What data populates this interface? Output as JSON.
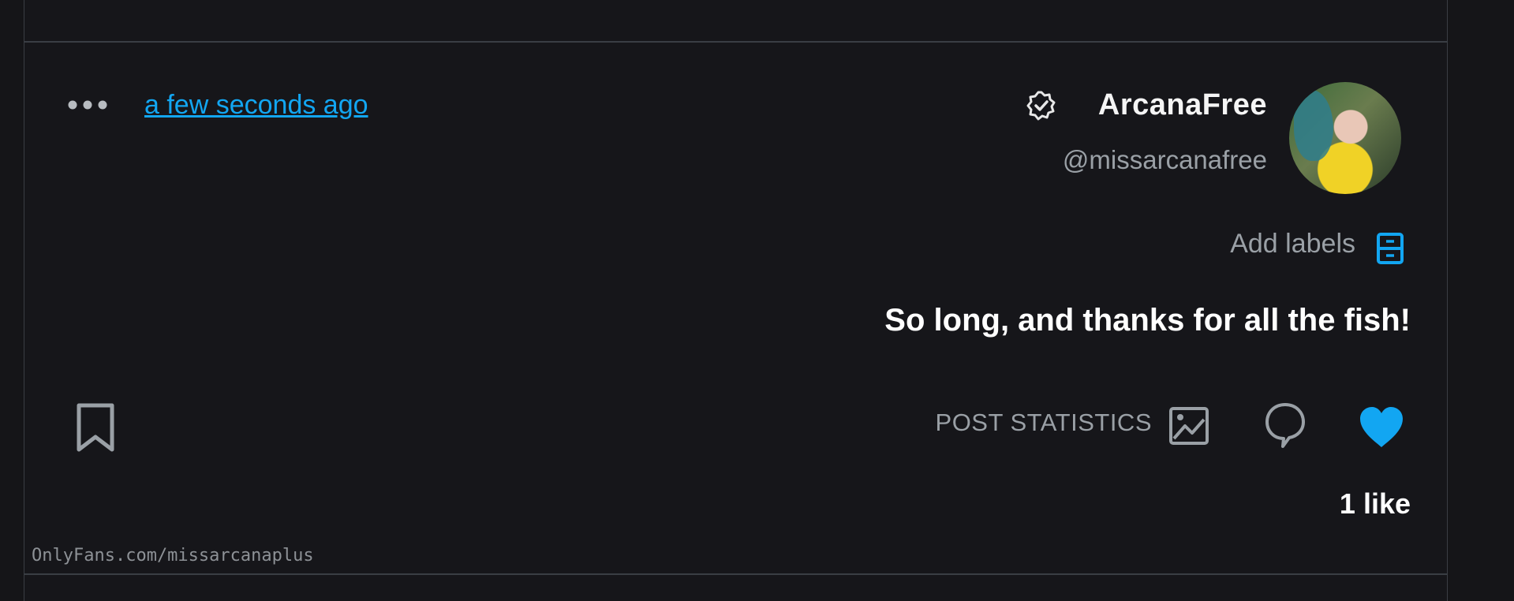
{
  "post": {
    "author": {
      "display_name": "ArcanaFree",
      "handle": "@missarcanafree",
      "verified_icon": "verified-badge-icon",
      "avatar_icon": "avatar-photo"
    },
    "timestamp": "a few seconds ago",
    "more_icon": "more-dots-icon",
    "labels": {
      "icon": "label-folder-icon",
      "text": "Add labels"
    },
    "text": "So long, and thanks for all the fish!",
    "actions": {
      "like_icon": "heart-icon",
      "comment_icon": "comment-bubble-icon",
      "stats_icon": "image-stats-icon",
      "stats_label": "POST STATISTICS",
      "bookmark_icon": "bookmark-icon"
    },
    "likes": "1 like",
    "watermark": "OnlyFans.com/missarcanaplus"
  },
  "colors": {
    "background": "#16161a",
    "accent": "#12a6f2",
    "text_primary": "#ffffff",
    "text_secondary": "#9aa0a6",
    "border": "#3a3e44"
  }
}
